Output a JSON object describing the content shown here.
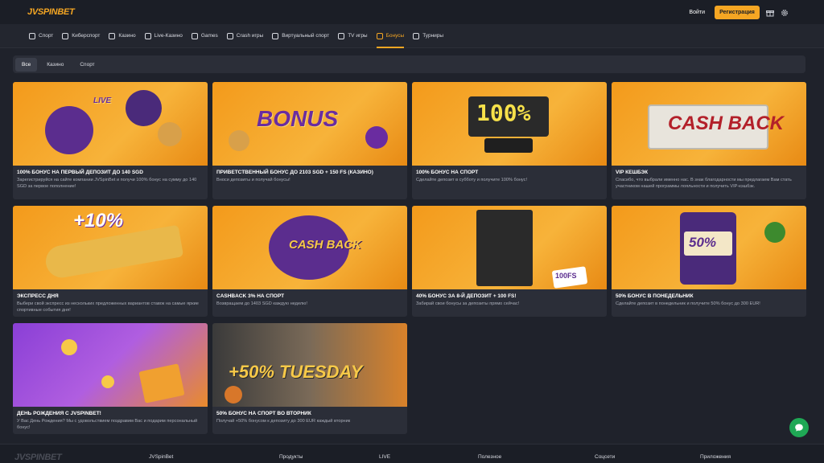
{
  "header": {
    "logo": "JVSPINBET",
    "login": "Войти",
    "register": "Регистрация",
    "icons": [
      "gift-icon",
      "gear-icon"
    ]
  },
  "nav": [
    {
      "label": "Спорт",
      "icon": "soccer-ball-icon"
    },
    {
      "label": "Киберспорт",
      "icon": "gamepad-icon"
    },
    {
      "label": "Казино",
      "icon": "cards-icon"
    },
    {
      "label": "Live-Казино",
      "icon": "live-icon"
    },
    {
      "label": "Games",
      "icon": "dice-icon"
    },
    {
      "label": "Crash игры",
      "icon": "rocket-icon"
    },
    {
      "label": "Виртуальный спорт",
      "icon": "vr-icon"
    },
    {
      "label": "TV игры",
      "icon": "tv-icon"
    },
    {
      "label": "Бонусы",
      "icon": "bonus-icon",
      "active": true
    },
    {
      "label": "Турниры",
      "icon": "trophy-icon"
    }
  ],
  "filters": [
    {
      "label": "Все",
      "active": true
    },
    {
      "label": "Казино"
    },
    {
      "label": "Спорт"
    }
  ],
  "cards": [
    {
      "title": "100% БОНУС НА ПЕРВЫЙ ДЕПОЗИТ ДО 140 SGD",
      "desc": "Зарегистрируйся на сайте компании JVSpinBet и получи 100% бонус на сумму до 140 SGD за первое пополнение!",
      "art": "LIVE"
    },
    {
      "title": "ПРИВЕТСТВЕННЫЙ БОНУС ДО 2103 SGD + 150 FS (КАЗИНО)",
      "desc": "Вноси депозиты и получай бонусы!",
      "art": "BONUS"
    },
    {
      "title": "100% БОНУС НА СПОРТ",
      "desc": "Сделайте депозит в субботу и получите 100% бонус!",
      "art": "100%"
    },
    {
      "title": "VIP КЕШБЭК",
      "desc": "Спасибо, что выбрали именно нас. В знак благодарности мы предлагаем Вам стать участником нашей программы лояльности и получить VIP-кэшбэк.",
      "art": "CASH BACK"
    },
    {
      "title": "ЭКСПРЕСС ДНЯ",
      "desc": "Выбери свой экспресс из нескольких предложенных вариантов ставок на самые яркие спортивные события дня!",
      "art": "+10%"
    },
    {
      "title": "CASHBACK 3% НА СПОРТ",
      "desc": "Возвращаем до 1403 SGD каждую неделю!",
      "art": "CASH BACK"
    },
    {
      "title": "40% БОНУС ЗА 8-Й ДЕПОЗИТ + 100 FS!",
      "desc": "Забирай свои бонусы за депозиты прямо сейчас!",
      "art": "100FS"
    },
    {
      "title": "50% БОНУС В ПОНЕДЕЛЬНИК",
      "desc": "Сделайте депозит в понедельник и получите 50% бонус до 300 EUR!",
      "art": "50%"
    },
    {
      "title": "ДЕНЬ РОЖДЕНИЯ С JVSPINBET!",
      "desc": "У Вас День Рождения? Мы с удовольствием поздравим Вас и подарим персональный бонус!",
      "art": ""
    },
    {
      "title": "50% БОНУС НА СПОРТ ВО ВТОРНИК",
      "desc": "Получай +50% бонусом к депозиту до 300 EUR каждый вторник",
      "art": "+50% TUESDAY"
    }
  ],
  "footer": {
    "logo": "JVSPINBET",
    "cols": [
      "JVSpinBet",
      "Продукты",
      "LIVE",
      "Полезное",
      "Соцсети",
      "Приложения"
    ]
  },
  "colors": {
    "accent": "#f5a623",
    "bg": "#1f222b",
    "card": "#2b2e38",
    "chat": "#1fa855"
  }
}
